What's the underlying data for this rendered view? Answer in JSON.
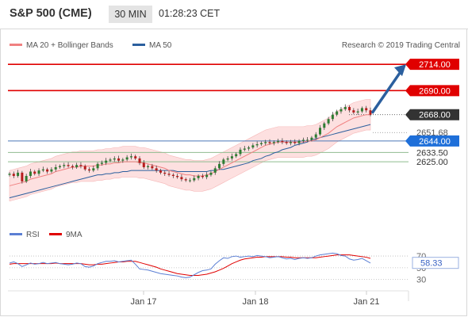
{
  "header": {
    "title": "S&P 500 (CME)",
    "timeframe": "30 MIN",
    "time": "01:28:23 CET"
  },
  "colors": {
    "resistance": "#e00000",
    "ma20": "#f08080",
    "band_fill": "#fde0e0",
    "ma50": "#2b5f9e",
    "pivot_line": "#4a78b8",
    "support": "#8fbc8f",
    "price_tag": "#333333",
    "arrow": "#2b5f9e",
    "rsi": "#5b7fd4",
    "rsi_ma": "#e00000"
  },
  "chart_data": [
    {
      "type": "candlestick",
      "legend": [
        {
          "label": "MA 20 + Bollinger Bands",
          "color": "#f08080"
        },
        {
          "label": "MA 50",
          "color": "#2b5f9e"
        }
      ],
      "source": "Research © 2019 Trading Central",
      "x_ticks": [
        "Jan 17",
        "Jan 18",
        "Jan 21"
      ],
      "ylim": [
        2570,
        2725
      ],
      "levels": [
        {
          "label": "2714.00",
          "value": 2714.0,
          "kind": "resistance"
        },
        {
          "label": "2690.00",
          "value": 2690.0,
          "kind": "resistance"
        },
        {
          "label": "2668.00",
          "value": 2668.0,
          "kind": "last"
        },
        {
          "label": "2651.68",
          "value": 2651.68,
          "kind": "plain"
        },
        {
          "label": "2644.00",
          "value": 2644.0,
          "kind": "pivot"
        },
        {
          "label": "2633.50",
          "value": 2633.5,
          "kind": "support"
        },
        {
          "label": "2625.00",
          "value": 2625.0,
          "kind": "support"
        }
      ],
      "close": [
        2614,
        2612,
        2615,
        2607,
        2612,
        2616,
        2614,
        2617,
        2618,
        2616,
        2618,
        2620,
        2621,
        2622,
        2621,
        2620,
        2622,
        2621,
        2618,
        2617,
        2619,
        2623,
        2624,
        2626,
        2627,
        2628,
        2626,
        2627,
        2629,
        2630,
        2628,
        2624,
        2620,
        2621,
        2619,
        2617,
        2615,
        2614,
        2613,
        2612,
        2611,
        2609,
        2608,
        2608,
        2610,
        2612,
        2611,
        2613,
        2615,
        2619,
        2623,
        2627,
        2628,
        2630,
        2632,
        2636,
        2637,
        2638,
        2640,
        2641,
        2642,
        2643,
        2642,
        2643,
        2644,
        2643,
        2642,
        2643,
        2642,
        2644,
        2645,
        2645,
        2647,
        2650,
        2656,
        2660,
        2664,
        2668,
        2671,
        2673,
        2675,
        2672,
        2670,
        2671,
        2674,
        2672,
        2668
      ],
      "ma20": [
        2603,
        2604,
        2605,
        2606,
        2607,
        2609,
        2610,
        2611,
        2612,
        2613,
        2614,
        2616,
        2617,
        2618,
        2619,
        2620,
        2620,
        2621,
        2621,
        2621,
        2621,
        2622,
        2622,
        2623,
        2623,
        2624,
        2624,
        2625,
        2625,
        2625,
        2625,
        2624,
        2624,
        2623,
        2622,
        2621,
        2620,
        2619,
        2617,
        2616,
        2615,
        2614,
        2613,
        2613,
        2612,
        2612,
        2612,
        2613,
        2614,
        2616,
        2618,
        2620,
        2622,
        2624,
        2626,
        2628,
        2630,
        2632,
        2634,
        2636,
        2638,
        2640,
        2641,
        2642,
        2643,
        2643,
        2643,
        2643,
        2643,
        2643,
        2643,
        2644,
        2644,
        2645,
        2647,
        2649,
        2651,
        2654,
        2657,
        2659,
        2661,
        2663,
        2665,
        2666,
        2667,
        2668,
        2668
      ],
      "ma50": [
        2592,
        2593,
        2594,
        2595,
        2596,
        2597,
        2598,
        2599,
        2600,
        2601,
        2602,
        2603,
        2604,
        2605,
        2606,
        2607,
        2608,
        2609,
        2610,
        2611,
        2612,
        2613,
        2613,
        2614,
        2614,
        2615,
        2615,
        2616,
        2616,
        2617,
        2617,
        2617,
        2617,
        2617,
        2617,
        2617,
        2617,
        2617,
        2617,
        2617,
        2616,
        2616,
        2616,
        2616,
        2616,
        2616,
        2616,
        2616,
        2617,
        2617,
        2618,
        2618,
        2619,
        2620,
        2621,
        2622,
        2623,
        2624,
        2626,
        2627,
        2628,
        2630,
        2631,
        2633,
        2634,
        2636,
        2637,
        2638,
        2640,
        2641,
        2642,
        2643,
        2645,
        2646,
        2647,
        2648,
        2649,
        2650,
        2651,
        2652,
        2653,
        2654,
        2655,
        2656,
        2657,
        2658,
        2659
      ],
      "projection": {
        "from": 2668,
        "to": 2714
      }
    },
    {
      "type": "line",
      "legend": [
        {
          "label": "RSI",
          "color": "#5b7fd4"
        },
        {
          "label": "9MA",
          "color": "#e00000"
        }
      ],
      "y_ticks": [
        70,
        50,
        30
      ],
      "ylim": [
        20,
        85
      ],
      "last_value": "58.33",
      "rsi": [
        58,
        60,
        57,
        52,
        55,
        58,
        56,
        57,
        59,
        57,
        58,
        59,
        57,
        56,
        55,
        56,
        58,
        57,
        52,
        51,
        53,
        57,
        59,
        61,
        61,
        62,
        60,
        61,
        62,
        63,
        56,
        48,
        47,
        46,
        44,
        42,
        40,
        39,
        38,
        37,
        36,
        34,
        33,
        34,
        38,
        42,
        45,
        46,
        48,
        56,
        62,
        67,
        66,
        69,
        70,
        68,
        69,
        70,
        69,
        71,
        70,
        69,
        67,
        68,
        69,
        67,
        65,
        66,
        64,
        66,
        67,
        66,
        67,
        70,
        72,
        73,
        74,
        75,
        74,
        71,
        70,
        65,
        63,
        64,
        66,
        62,
        58
      ],
      "rsi_9ma": [
        56,
        57,
        57,
        57,
        57,
        57,
        57,
        57,
        57,
        57,
        57,
        58,
        57,
        57,
        57,
        57,
        57,
        57,
        56,
        55,
        55,
        56,
        56,
        57,
        58,
        59,
        60,
        60,
        61,
        61,
        61,
        59,
        57,
        55,
        53,
        51,
        48,
        46,
        44,
        42,
        40,
        39,
        38,
        37,
        37,
        37,
        38,
        39,
        41,
        43,
        46,
        49,
        53,
        57,
        60,
        63,
        65,
        66,
        67,
        68,
        68,
        69,
        69,
        69,
        69,
        69,
        68,
        68,
        67,
        67,
        67,
        67,
        67,
        67,
        68,
        69,
        70,
        71,
        72,
        72,
        72,
        72,
        71,
        70,
        69,
        68,
        66
      ]
    }
  ]
}
